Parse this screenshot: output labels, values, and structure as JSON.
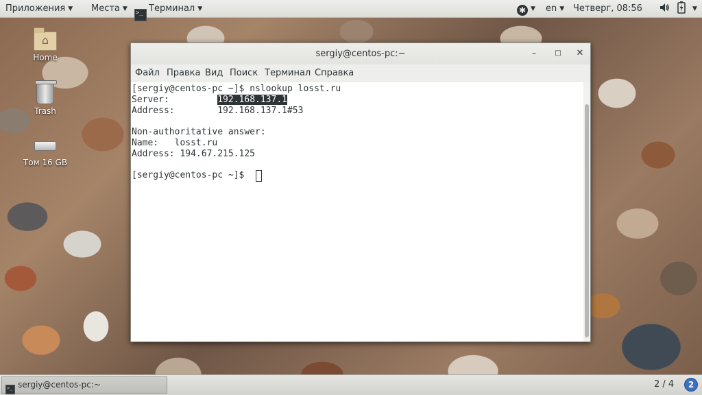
{
  "top_panel": {
    "applications_label": "Приложения",
    "places_label": "Места",
    "active_app_label": "Терминал",
    "language": "en",
    "clock": "Четверг, 08:56",
    "accessibility_icon": "accessibility-icon",
    "volume_icon": "volume-icon",
    "battery_icon": "battery-icon"
  },
  "desktop": {
    "icons": [
      {
        "label": "Home",
        "icon": "home-folder-icon"
      },
      {
        "label": "Trash",
        "icon": "trash-icon"
      },
      {
        "label": "Том 16 GB",
        "icon": "drive-icon"
      }
    ]
  },
  "window": {
    "title": "sergiy@centos-pc:~",
    "minimize_symbol": "–",
    "maximize_symbol": "□",
    "close_symbol": "✕",
    "menu": [
      "Файл",
      "Правка",
      "Вид",
      "Поиск",
      "Терминал",
      "Справка"
    ]
  },
  "terminal": {
    "lines": {
      "cmd_prompt": "[sergiy@centos-pc ~]$ ",
      "cmd": "nslookup losst.ru",
      "server_label": "Server:         ",
      "server_value": "192.168.137.1",
      "address1": "Address:        192.168.137.1#53",
      "nonauth": "Non-authoritative answer:",
      "name": "Name:   losst.ru",
      "address2": "Address: 194.67.215.125",
      "prompt2": "[sergiy@centos-pc ~]$ "
    }
  },
  "bottom_panel": {
    "task_label": "sergiy@centos-pc:~",
    "workspace_text": "2 / 4",
    "workspace_badge": "2"
  }
}
